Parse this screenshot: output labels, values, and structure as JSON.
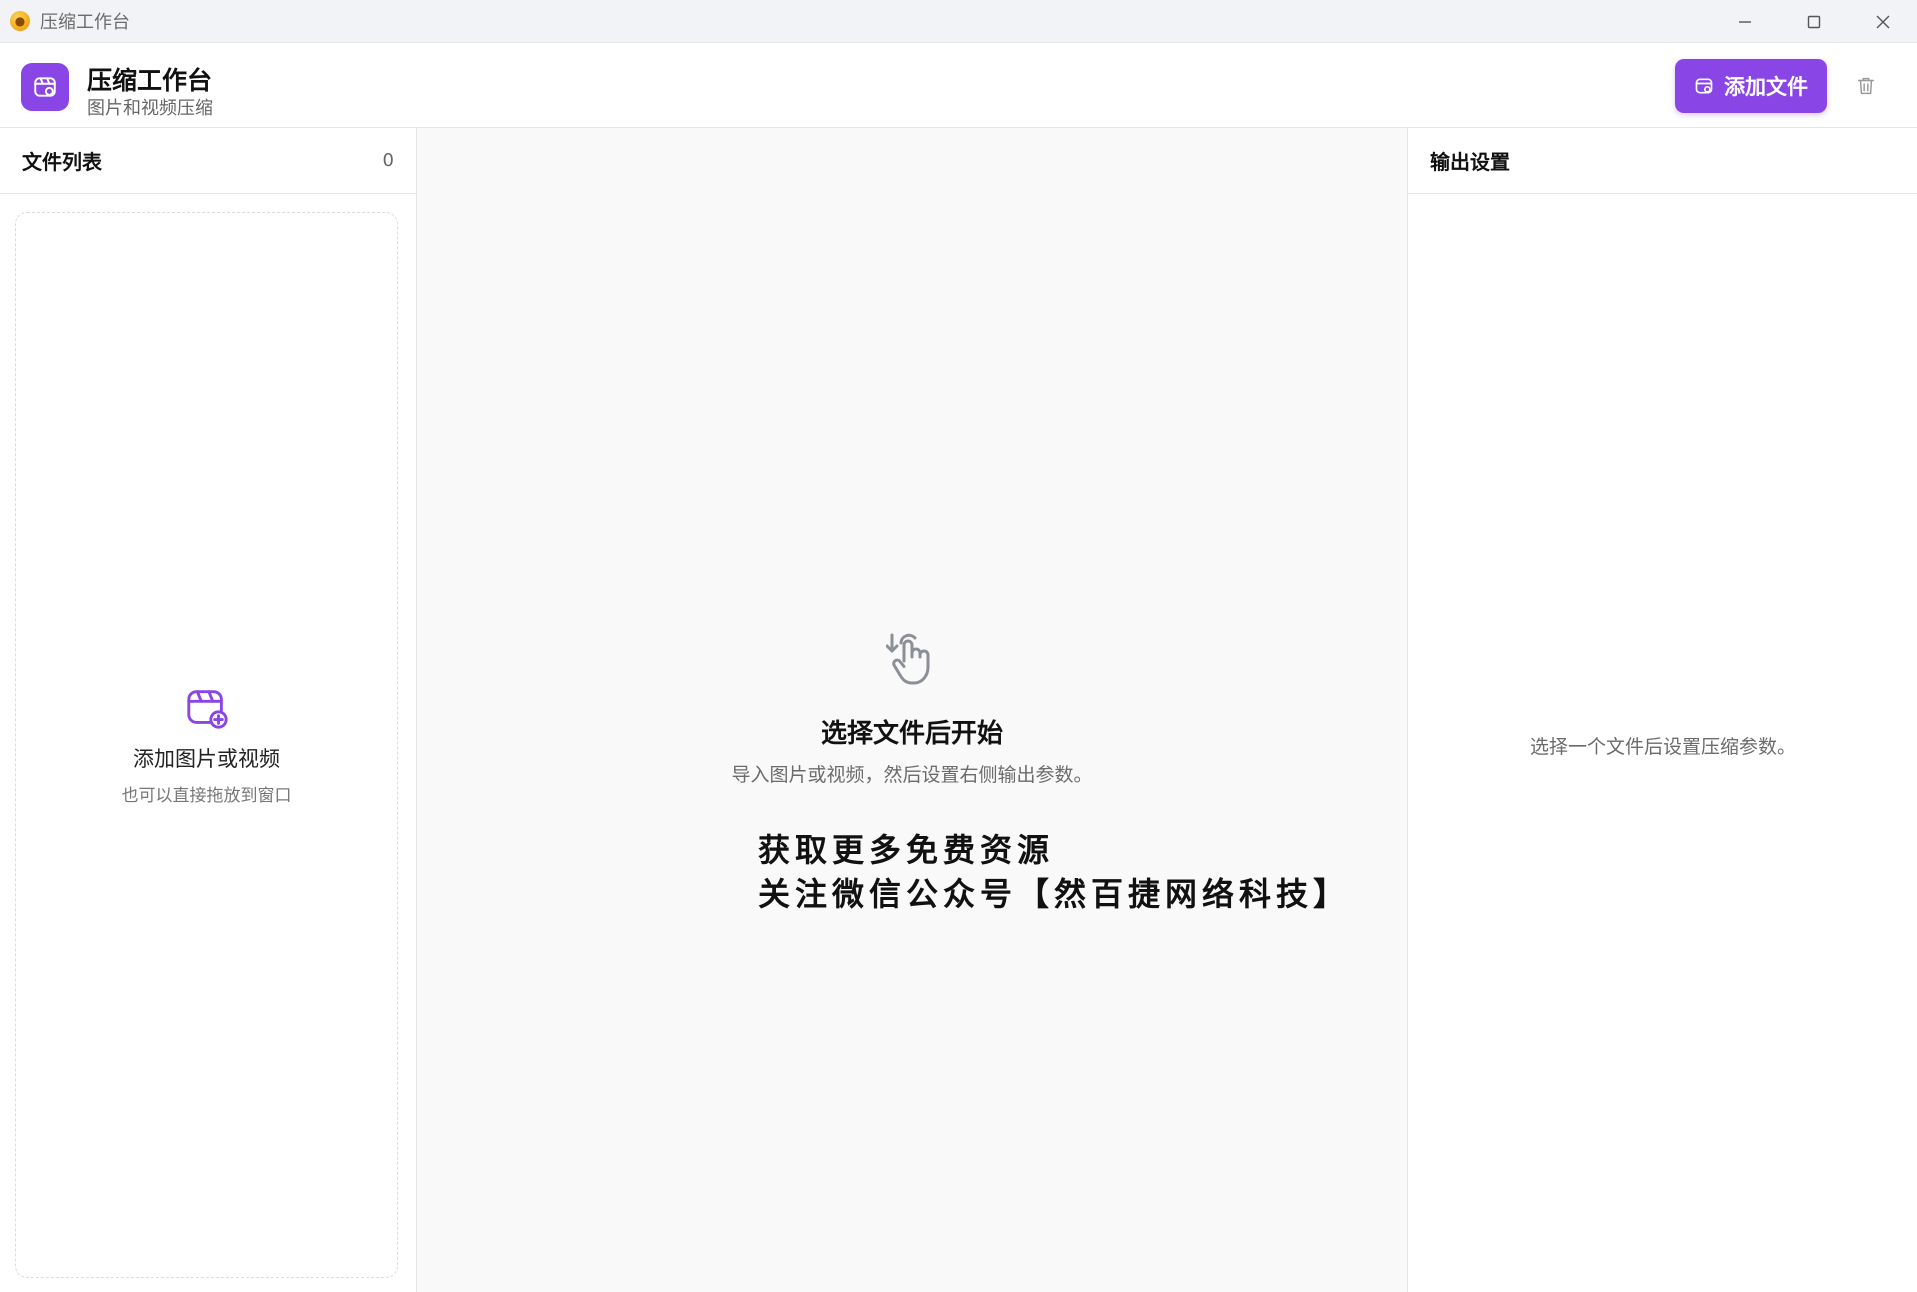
{
  "window": {
    "title": "压缩工作台"
  },
  "header": {
    "app_title": "压缩工作台",
    "app_subtitle": "图片和视频压缩",
    "add_button_label": "添加文件"
  },
  "file_list": {
    "title": "文件列表",
    "count": "0",
    "dropzone_title": "添加图片或视频",
    "dropzone_subtitle": "也可以直接拖放到窗口"
  },
  "main": {
    "empty_title": "选择文件后开始",
    "empty_subtitle": "导入图片或视频，然后设置右侧输出参数。",
    "promo_line1": "获取更多免费资源",
    "promo_line2": "关注微信公众号【然百捷网络科技】"
  },
  "output_settings": {
    "title": "输出设置",
    "hint": "选择一个文件后设置压缩参数。"
  },
  "colors": {
    "accent": "#8a45e6",
    "panel_bg": "#f9f9f9",
    "border": "#e5e5e5"
  },
  "icons": {
    "app_logo": "app-logo-icon",
    "brand": "calendar-add-icon",
    "trash": "trash-icon",
    "hand": "hand-tap-icon",
    "minimize": "minimize-icon",
    "maximize": "maximize-icon",
    "close": "close-icon"
  }
}
